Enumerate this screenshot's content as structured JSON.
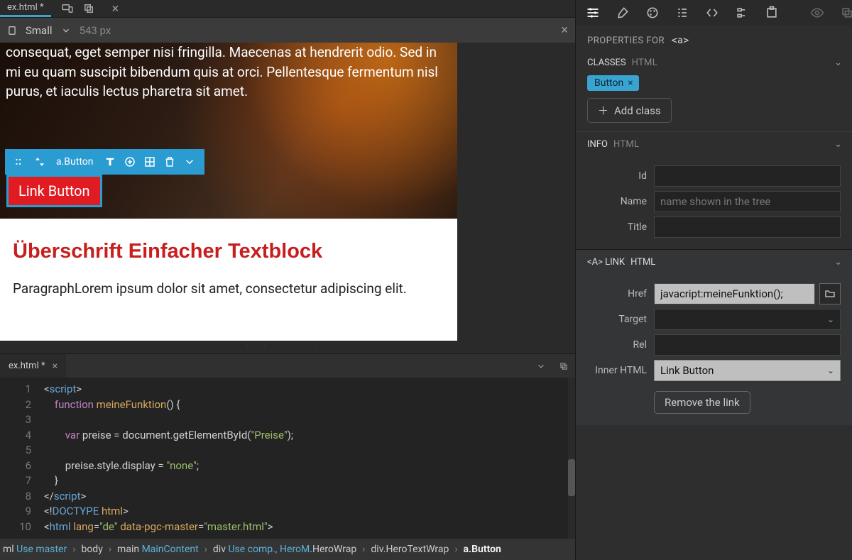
{
  "tab": {
    "filename": "ex.html *"
  },
  "device_bar": {
    "label": "Small",
    "width": "543 px"
  },
  "preview": {
    "hero_text": "consequat, eget semper nisi fringilla. Maecenas at hendrerit odio. Sed in mi eu quam suscipit bibendum quis at orci. Pellentesque fermentum nisl purus, et iaculis lectus pharetra sit amet.",
    "selection_label": "a.Button",
    "link_button": "Link Button",
    "content_heading": "Überschrift Einfacher Textblock",
    "content_para": "ParagraphLorem ipsum dolor sit amet, consectetur adipiscing elit."
  },
  "code": {
    "tab_filename": "ex.html *",
    "lines": [
      {
        "n": 1,
        "html": "<span class='t-punc'>&lt;</span><span class='t-tag'>script</span><span class='t-punc'>&gt;</span>"
      },
      {
        "n": 2,
        "html": "    <span class='t-kw'>function</span> <span class='t-fn'>meineFunktion</span>() {"
      },
      {
        "n": 3,
        "html": ""
      },
      {
        "n": 4,
        "html": "        <span class='t-kw'>var</span> preise = document.getElementById(<span class='t-str'>\"Preise\"</span>);"
      },
      {
        "n": 5,
        "html": ""
      },
      {
        "n": 6,
        "html": "        preise.style.display = <span class='t-str'>\"none\"</span>;"
      },
      {
        "n": 7,
        "html": "    }"
      },
      {
        "n": 8,
        "html": "<span class='t-punc'>&lt;/</span><span class='t-tag'>script</span><span class='t-punc'>&gt;</span>"
      },
      {
        "n": 9,
        "html": "<span class='t-punc'>&lt;!</span><span class='t-tag'>DOCTYPE</span> <span class='t-attr'>html</span><span class='t-punc'>&gt;</span>"
      },
      {
        "n": 10,
        "html": "<span class='t-punc'>&lt;</span><span class='t-tag'>html</span> <span class='t-attr'>lang</span>=<span class='t-str'>\"de\"</span> <span class='t-attr'>data-pgc-master</span>=<span class='t-str'>\"master.html\"</span><span class='t-punc'>&gt;</span>"
      }
    ]
  },
  "breadcrumb": {
    "segs": [
      {
        "pre": "ml ",
        "accent": "Use master"
      },
      {
        "pre": "body"
      },
      {
        "pre": "main ",
        "accent": "MainContent"
      },
      {
        "pre": "div ",
        "accent": "Use comp., HeroM",
        "post": ".HeroWrap"
      },
      {
        "pre": "div.HeroTextWrap"
      },
      {
        "pre": "a.Button",
        "strong": true
      }
    ]
  },
  "panel": {
    "properties_for_label": "PROPERTIES FOR",
    "properties_for_tag": "<a>",
    "classes": {
      "title": "CLASSES",
      "sub": "HTML",
      "chips": [
        "Button"
      ],
      "add_label": "Add class"
    },
    "info": {
      "title": "INFO",
      "sub": "HTML",
      "id_label": "Id",
      "id_value": "",
      "name_label": "Name",
      "name_placeholder": "name shown in the tree",
      "name_value": "",
      "title_label": "Title",
      "title_value": ""
    },
    "link": {
      "title": "<A> LINK",
      "sub": "HTML",
      "href_label": "Href",
      "href_value": "javacript:meineFunktion();",
      "target_label": "Target",
      "target_value": "",
      "rel_label": "Rel",
      "rel_value": "",
      "inner_label": "Inner HTML",
      "inner_value": "Link Button",
      "remove_label": "Remove the link"
    }
  }
}
